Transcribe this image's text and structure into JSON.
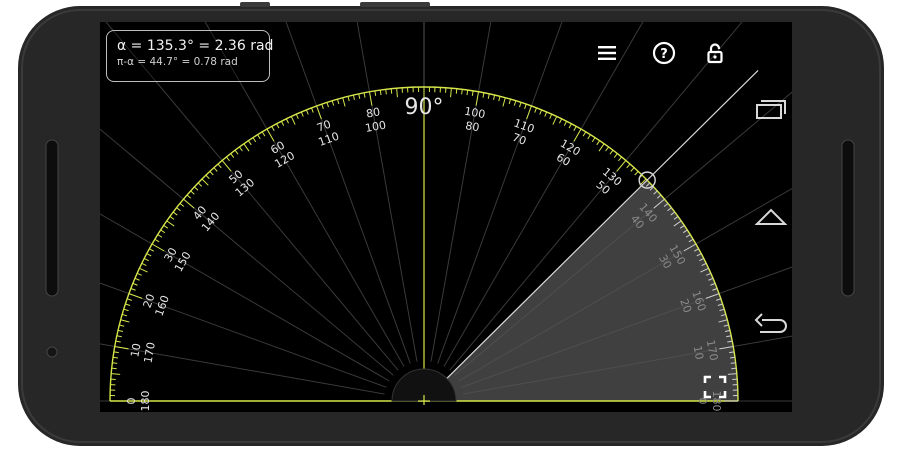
{
  "app": {
    "angle_readout": "α = 135.3° = 2.36 rad",
    "supplement_readout": "π-α = 44.7° = 0.78 rad"
  },
  "toolbar": {
    "icons": [
      "menu-icon",
      "help-icon",
      "lock-icon"
    ]
  },
  "protractor": {
    "top_label": "90°",
    "measured_angle_deg": 135.3,
    "outer_labels": [
      "0",
      "10",
      "20",
      "30",
      "40",
      "50",
      "60",
      "70",
      "80",
      "100",
      "110",
      "120",
      "130",
      "140",
      "150",
      "160",
      "170",
      "180"
    ],
    "inner_labels": [
      "180",
      "170",
      "160",
      "150",
      "140",
      "130",
      "120",
      "110",
      "100",
      "80",
      "70",
      "60",
      "50",
      "40",
      "30",
      "20",
      "10",
      "0"
    ]
  },
  "nav_bar": {
    "icons": [
      "recent-apps-icon",
      "home-icon",
      "back-icon"
    ]
  },
  "colors": {
    "device_body": "#262626",
    "screen": "#000000",
    "scale_accent": "#d7e64a",
    "highlight_sector": "#555555"
  }
}
